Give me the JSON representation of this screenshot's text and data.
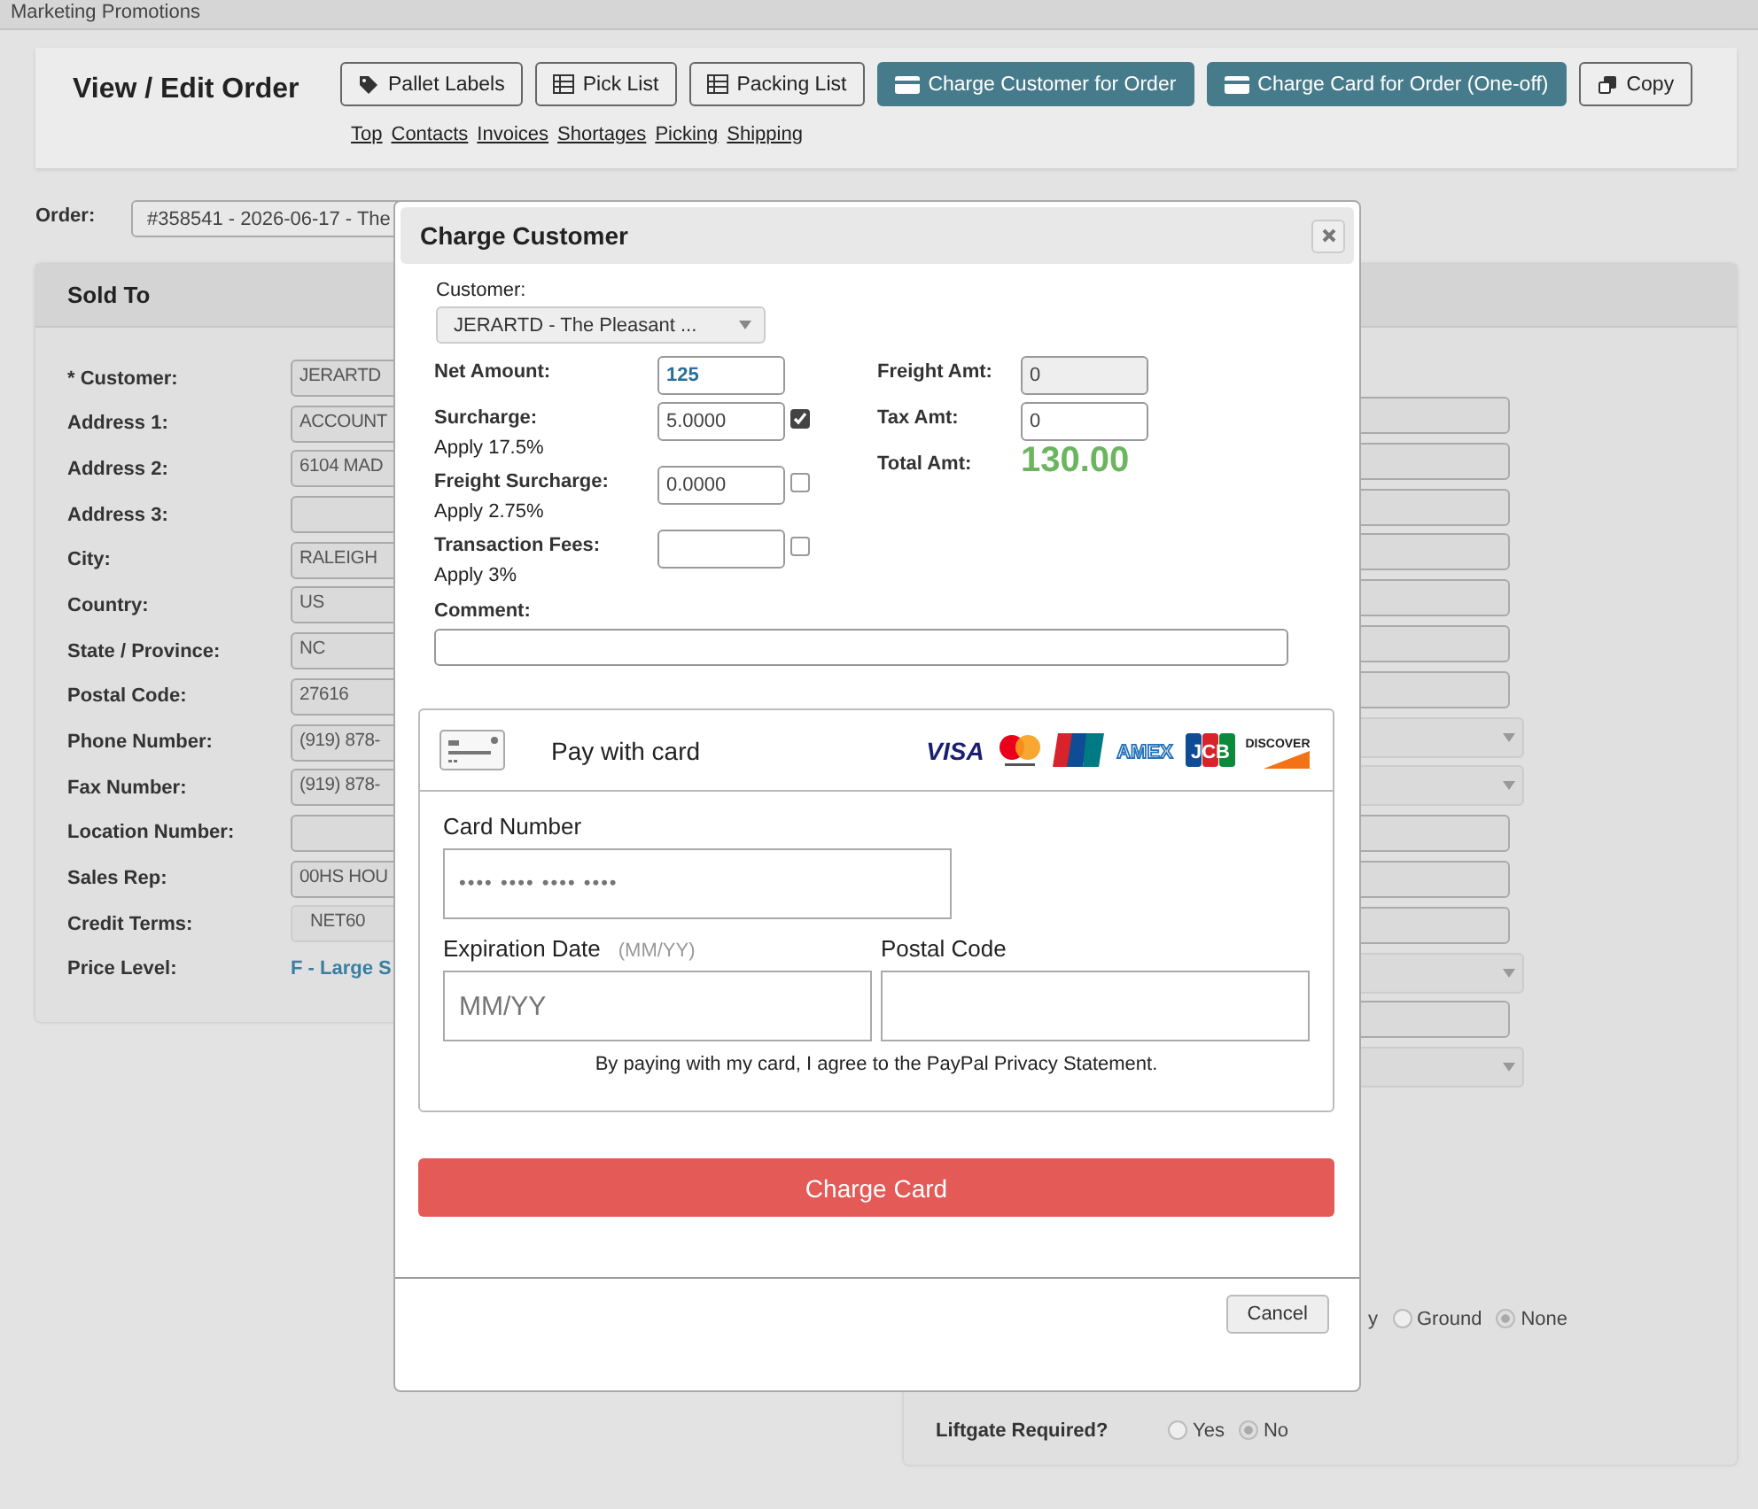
{
  "top_bar": {
    "title": "Marketing Promotions"
  },
  "header": {
    "title": "View / Edit Order",
    "buttons": [
      {
        "label": "Pallet Labels",
        "kind": "labels"
      },
      {
        "label": "Pick List",
        "kind": "document"
      },
      {
        "label": "Packing List",
        "kind": "document"
      },
      {
        "label": "Charge Customer for Order",
        "kind": "payment"
      },
      {
        "label": "Charge Card for Order (One-off)",
        "kind": "payment"
      },
      {
        "label": "Copy",
        "kind": "copy"
      }
    ],
    "links": [
      "Top",
      "Contacts",
      "Invoices",
      "Shortages",
      "Picking",
      "Shipping"
    ]
  },
  "order": {
    "label": "Order:",
    "value": "#358541 - 2026-06-17 - The"
  },
  "sold_to": {
    "title": "Sold To",
    "rows": [
      {
        "label": "* Customer:",
        "kind": "input",
        "value": "JERARTD"
      },
      {
        "label": "Address 1:",
        "kind": "input",
        "value": "ACCOUNT"
      },
      {
        "label": "Address 2:",
        "kind": "input",
        "value": "6104 MAD"
      },
      {
        "label": "Address 3:",
        "kind": "input"
      },
      {
        "label": "City:",
        "kind": "input",
        "value": "RALEIGH"
      },
      {
        "label": "Country:",
        "kind": "input",
        "value": "US"
      },
      {
        "label": "State / Province:",
        "kind": "input",
        "value": "NC"
      },
      {
        "label": "Postal Code:",
        "kind": "input",
        "value": "27616"
      },
      {
        "label": "Phone Number:",
        "kind": "input",
        "value": "(919) 878-"
      },
      {
        "label": "Fax Number:",
        "kind": "input",
        "value": "(919) 878-"
      },
      {
        "label": "Location Number:",
        "kind": "input"
      },
      {
        "label": "Sales Rep:",
        "kind": "input",
        "value": "00HS HOU"
      },
      {
        "label": "Credit Terms:",
        "kind": "select",
        "value": "NET60"
      },
      {
        "label": "Price Level:",
        "kind": "link",
        "value": "F - Large S"
      }
    ]
  },
  "right_panel": {
    "fields": [
      {
        "kind": "input"
      },
      {
        "kind": "input"
      },
      {
        "kind": "input"
      },
      {
        "kind": "input"
      },
      {
        "kind": "input"
      },
      {
        "kind": "input"
      },
      {
        "kind": "input"
      },
      {
        "kind": "select"
      },
      {
        "kind": "select"
      },
      {
        "kind": "input"
      },
      {
        "kind": "input"
      },
      {
        "kind": "input"
      },
      {
        "kind": "select"
      },
      {
        "kind": "input"
      },
      {
        "kind": "select"
      }
    ],
    "ship_cut_label": "y",
    "ship_options": [
      {
        "label": "Ground",
        "selected": false
      },
      {
        "label": "None",
        "selected": true
      }
    ],
    "liftgate": {
      "label": "Liftgate Required?",
      "options": [
        {
          "label": "Yes",
          "selected": false
        },
        {
          "label": "No",
          "selected": true
        }
      ]
    }
  },
  "modal": {
    "title": "Charge Customer",
    "customer_label": "Customer:",
    "customer": "JERARTD - The Pleasant ...",
    "amounts": [
      {
        "label": "Net Amount:",
        "value": "125",
        "kind": "net"
      },
      {
        "label": "Surcharge:",
        "value": "5.0000",
        "checked": true,
        "note": "Apply 17.5%",
        "kind": "fee"
      },
      {
        "label": "Freight Surcharge:",
        "value": "0.0000",
        "checked": false,
        "note": "Apply 2.75%",
        "kind": "fee"
      },
      {
        "label": "Transaction Fees:",
        "checked": false,
        "note": "Apply 3%",
        "kind": "fee"
      }
    ],
    "totals": [
      {
        "label": "Freight Amt:",
        "value": "0",
        "kind": "readonly"
      },
      {
        "label": "Tax Amt:",
        "value": "0",
        "kind": "input"
      },
      {
        "label": "Total Amt:",
        "value": "130.00",
        "kind": "total"
      }
    ],
    "comment_label": "Comment:",
    "card": {
      "title": "Pay with card",
      "brands": [
        {
          "kind": "visa",
          "label": "VISA"
        },
        {
          "kind": "mastercard"
        },
        {
          "kind": "unionpay"
        },
        {
          "kind": "amex",
          "label": "AMEX"
        },
        {
          "kind": "jcb",
          "label": "JCB"
        },
        {
          "kind": "discover",
          "label": "DISCOVER"
        }
      ],
      "number_label": "Card Number",
      "number_placeholder": "•••• •••• •••• ••••",
      "expiry_label": "Expiration Date",
      "expiry_hint": "(MM/YY)",
      "expiry_placeholder": "MM/YY",
      "postal_label": "Postal Code",
      "legal": "By paying with my card, I agree to the PayPal Privacy Statement."
    },
    "charge_button": "Charge Card",
    "cancel_button": "Cancel"
  }
}
